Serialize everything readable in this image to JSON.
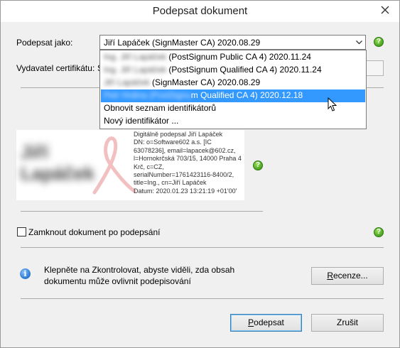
{
  "window": {
    "title": "Podepsat dokument"
  },
  "sign_as": {
    "label": "Podepsat jako:",
    "selected_value": "Jiří Lapáček (SignMaster CA) 2020.08.29"
  },
  "issuer": {
    "label": "Vydavatel certifikátu:",
    "partial_value": "S"
  },
  "dropdown": {
    "items": [
      {
        "hidden": "Ing. Jiří Lapáček",
        "text": "(PostSignum Public CA 4) 2020.11.24",
        "selected": false
      },
      {
        "hidden": "Ing. Jiří Lapáček",
        "text": "(PostSignum Qualified CA 4) 2020.11.24",
        "selected": false
      },
      {
        "hidden": "Jiří Lapáček",
        "text": "(SignMaster CA) 2020.08.29",
        "selected": false
      },
      {
        "hidden": "Petr Hrdina (PostSignu",
        "text": "m Qualified CA 4) 2020.12.18",
        "selected": true
      },
      {
        "hidden": "",
        "text": "Obnovit seznam identifikátorů",
        "selected": false
      },
      {
        "hidden": "",
        "text": "Nový identifikátor ...",
        "selected": false
      }
    ]
  },
  "signature_preview": {
    "name_blurred": "Jiří\nLapáček",
    "details": [
      "Digitálně podepsal Jiří Lapáček",
      "DN: o=Software602 a.s. [IC",
      "63078236], email=lapacek@602.cz,",
      "l=Hornokrčská 703/15, 14000 Praha 4",
      "Krč, c=CZ,",
      "serialNumber=1761423116-8400/2,",
      "title=Ing., cn=Jiří Lapáček",
      "Datum: 2020.01.23 13:21:19 +01'00'"
    ]
  },
  "lock": {
    "label": "Zamknout dokument po podepsání",
    "checked": false
  },
  "info": {
    "text": "Klepněte na Zkontrolovat, abyste viděli, zda obsah dokumentu může ovlivnit podepisování"
  },
  "buttons": {
    "review": "Recenze...",
    "sign": "Podepsat",
    "cancel": "Zrušit"
  },
  "icons": {
    "help": "help-icon",
    "info": "info-icon",
    "close": "close-icon",
    "dropdown": "chevron-down-icon",
    "cursor": "mouse-pointer-icon"
  },
  "colors": {
    "selection": "#3399ff",
    "help_green": "#58b02a",
    "info_blue": "#2f7fd6",
    "dialog_bg": "#f0f0f0"
  }
}
